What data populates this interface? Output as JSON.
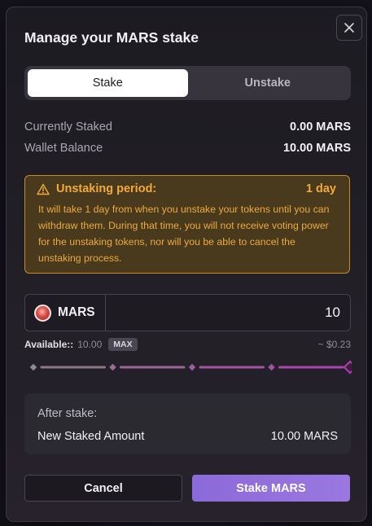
{
  "modal": {
    "title": "Manage your MARS stake"
  },
  "tabs": [
    {
      "label": "Stake",
      "active": true
    },
    {
      "label": "Unstake",
      "active": false
    }
  ],
  "summary": {
    "currently_staked_label": "Currently Staked",
    "currently_staked_value": "0.00 MARS",
    "wallet_balance_label": "Wallet Balance",
    "wallet_balance_value": "10.00 MARS"
  },
  "warning": {
    "title": "Unstaking period:",
    "duration": "1 day",
    "body": "It will take 1 day from when you unstake your tokens until you can withdraw them. During that time, you will not receive voting power for the unstaking tokens, nor will you be able to cancel the unstaking process."
  },
  "amount": {
    "token_symbol": "MARS",
    "value": "10",
    "available_label": "Available::",
    "available_value": "10.00",
    "max_label": "MAX",
    "usd_value": "~ $0.23"
  },
  "slider": {
    "fraction": 1.0,
    "marks": [
      0,
      0.25,
      0.5,
      0.75,
      1
    ]
  },
  "after_stake": {
    "title": "After stake:",
    "label": "New Staked Amount",
    "value": "10.00 MARS"
  },
  "actions": {
    "cancel_label": "Cancel",
    "stake_label": "Stake MARS"
  },
  "colors": {
    "accent": "#9a78e0",
    "warning": "#f2a93a",
    "slider_start": "#8b7f86",
    "slider_end": "#b23bb4"
  },
  "icons": {
    "close": "close-icon",
    "warning": "warning-triangle-icon",
    "token": "mars-token-icon"
  }
}
